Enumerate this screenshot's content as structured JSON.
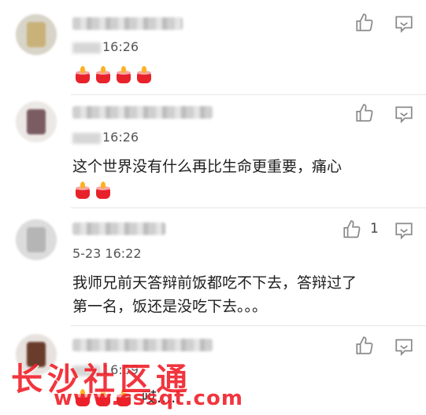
{
  "comments": [
    {
      "time": "16:26",
      "text": "",
      "candles": 4,
      "likes": "",
      "avatar_colors": [
        "#d8d4c8",
        "#c8b27a"
      ]
    },
    {
      "time": "16:26",
      "text": "这个世界没有什么再比生命更重要，痛心",
      "candles": 2,
      "likes": "",
      "avatar_colors": [
        "#ece8e6",
        "#7a5c62"
      ]
    },
    {
      "time": "5-23 16:22",
      "text": "我师兄前天答辩前饭都吃不下去，答辩过了第一名，饭还是没吃下去。。。",
      "text_line1": "我师兄前天答辩前饭都吃不下去，答辩过了",
      "text_line2": "第一名，饭还是没吃下去。。。",
      "candles": 0,
      "likes": "1",
      "avatar_colors": [
        "#dcdcdc",
        "#b5b5b5"
      ]
    },
    {
      "time": "16:59",
      "text": "哎.....",
      "candles": 3,
      "likes": "",
      "avatar_colors": [
        "#e7e2de",
        "#6a3c2c"
      ]
    }
  ],
  "icons": {
    "like": "thumbs-up-icon",
    "reply": "comment-bubble-icon",
    "candle": "candle-emoji-icon"
  },
  "watermark": {
    "title": "长沙社区通",
    "url": "www.cssqt.com"
  },
  "colors": {
    "icon": "#8a8a8a",
    "watermark": "#f0202a",
    "divider": "#e6e6e6"
  }
}
